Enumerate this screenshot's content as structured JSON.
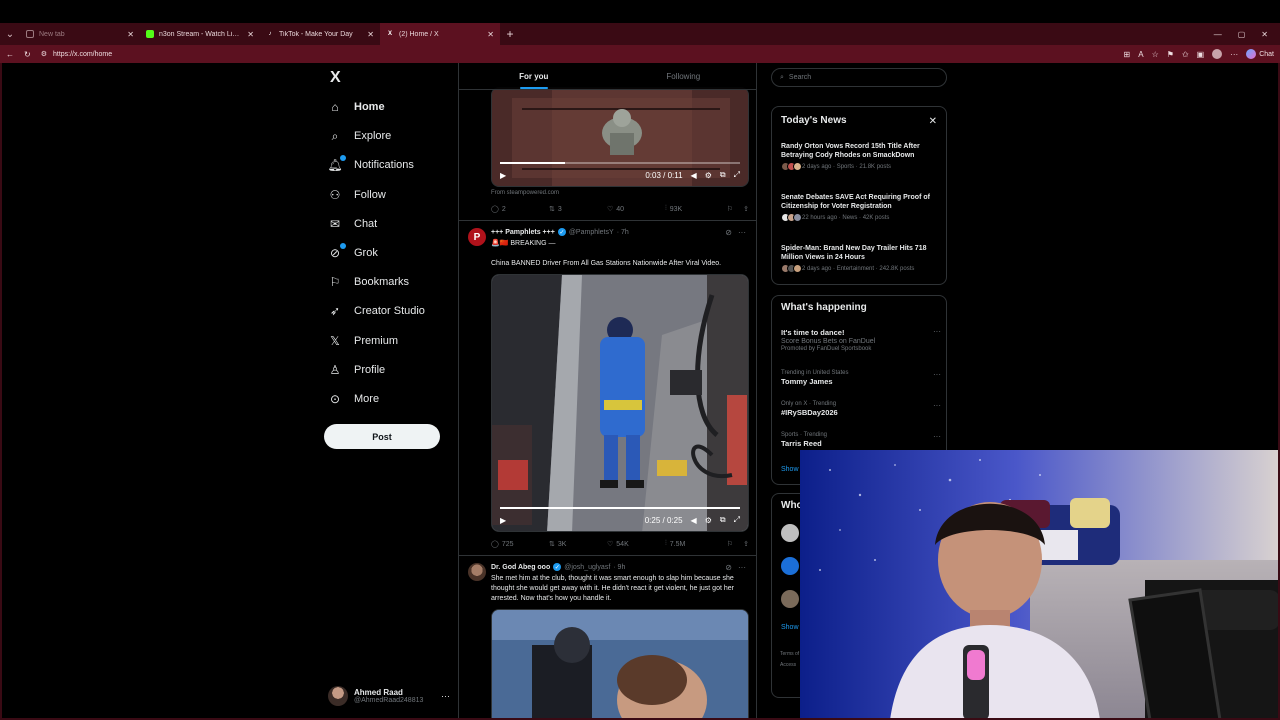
{
  "browser": {
    "tabs": [
      {
        "title": "New tab",
        "active": false,
        "color": "#9c7a80"
      },
      {
        "title": "n3on Stream - Watch Live on Kick",
        "active": false,
        "color": "#53fc18"
      },
      {
        "title": "TikTok - Make Your Day",
        "active": false,
        "color": "#ffffff"
      },
      {
        "title": "(2) Home / X",
        "active": true,
        "color": "#ffffff"
      }
    ],
    "url": "https://x.com/home",
    "chat_label": "Chat",
    "accent": "#5c1120"
  },
  "nav": {
    "logo": "X",
    "items": [
      {
        "label": "Home",
        "icon": "home-icon",
        "glyph": "⌂",
        "active": true
      },
      {
        "label": "Explore",
        "icon": "search-icon",
        "glyph": "⌕"
      },
      {
        "label": "Notifications",
        "icon": "bell-icon",
        "glyph": "🔔︎",
        "dot": true
      },
      {
        "label": "Follow",
        "icon": "person-add-icon",
        "glyph": "⚇"
      },
      {
        "label": "Chat",
        "icon": "mail-icon",
        "glyph": "✉"
      },
      {
        "label": "Grok",
        "icon": "grok-icon",
        "glyph": "⊘",
        "dot": true
      },
      {
        "label": "Bookmarks",
        "icon": "bookmark-icon",
        "glyph": "⚐"
      },
      {
        "label": "Creator Studio",
        "icon": "rocket-icon",
        "glyph": "➶"
      },
      {
        "label": "Premium",
        "icon": "x-logo-icon",
        "glyph": "𝕏"
      },
      {
        "label": "Profile",
        "icon": "person-icon",
        "glyph": "♙"
      },
      {
        "label": "More",
        "icon": "more-circle-icon",
        "glyph": "⊙"
      }
    ],
    "post_label": "Post",
    "profile": {
      "name": "Ahmed Raad",
      "handle": "@AhmedRaad248813",
      "more": "···"
    }
  },
  "feed": {
    "tabs": [
      "For you",
      "Following"
    ],
    "tweet1": {
      "video_time": "0:03 / 0:11",
      "progress": 0.27,
      "source": "From steampowered.com",
      "replies": "2",
      "reposts": "3",
      "likes": "40",
      "views": "93K"
    },
    "tweet2": {
      "name": "+++ Pamphlets +++",
      "handle": "@PamphletsY",
      "time": "· 7h",
      "line1": "🚨🇨🇳 BREAKING —",
      "text": "China BANNED Driver From All Gas Stations Nationwide After Viral Video.",
      "video_time": "0:25 / 0:25",
      "progress": 1.0,
      "replies": "725",
      "reposts": "3K",
      "likes": "54K",
      "views": "7.5M"
    },
    "tweet3": {
      "name": "Dr. God Abeg ooo",
      "handle": "@josh_uglyasf",
      "time": "· 9h",
      "text": "She met him at the club, thought it was smart enough to slap him because she thought she would get away with it. He didn't react it get violent, he just got her arrested. Now that's how you handle it."
    }
  },
  "right": {
    "search_placeholder": "Search",
    "todays_news": {
      "title": "Today's News",
      "close": "✕",
      "items": [
        {
          "headline": "Randy Orton Vows Record 15th Title After Betraying Cody Rhodes on SmackDown",
          "meta": "2 days ago · Sports · 21.8K posts"
        },
        {
          "headline": "Senate Debates SAVE Act Requiring Proof of Citizenship for Voter Registration",
          "meta": "22 hours ago · News · 42K posts"
        },
        {
          "headline": "Spider-Man: Brand New Day Trailer Hits 718 Million Views in 24 Hours",
          "meta": "2 days ago · Entertainment · 242.8K posts"
        }
      ]
    },
    "whats_happening": {
      "title": "What's happening",
      "items": [
        {
          "name": "It's time to dance!",
          "sub": "Score Bonus Bets on FanDuel",
          "promo": "Promoted by FanDuel Sportsbook"
        },
        {
          "ctx": "Trending in United States",
          "name": "Tommy James"
        },
        {
          "ctx": "Only on X · Trending",
          "name": "#IRySBDay2026"
        },
        {
          "ctx": "Sports · Trending",
          "name": "Tarris Reed"
        }
      ],
      "show_more": "Show"
    },
    "who_to_follow": {
      "title": "Who",
      "show_more": "Show"
    },
    "footer": {
      "terms": "Terms of",
      "access": "Access"
    }
  }
}
